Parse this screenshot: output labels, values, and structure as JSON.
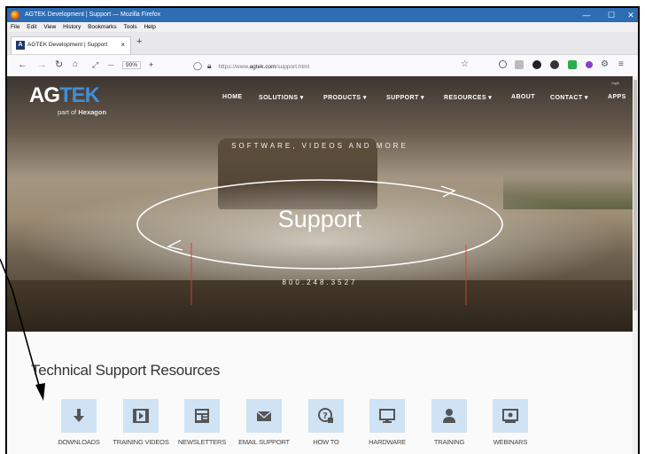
{
  "browser": {
    "window_title": "AGTEK Development | Support — Mozilla Firefox",
    "menu": [
      "File",
      "Edit",
      "View",
      "History",
      "Bookmarks",
      "Tools",
      "Help"
    ],
    "tab_title": "AGTEK Development | Support",
    "tab_close": "×",
    "new_tab": "+",
    "zoom_minus": "—",
    "zoom_level": "90%",
    "zoom_plus": "+",
    "url_prefix": "https://www.",
    "url_domain": "agtek.com",
    "url_path": "/support.html",
    "win_minimize": "—",
    "win_maximize": "☐",
    "win_close": "✕"
  },
  "site": {
    "logo_ag": "AG",
    "logo_tek": "TEK",
    "logo_sub_prefix": "part of ",
    "logo_sub_brand": "Hexagon",
    "login": "login",
    "nav": [
      "HOME",
      "SOLUTIONS ▾",
      "PRODUCTS ▾",
      "SUPPORT ▾",
      "RESOURCES ▾",
      "ABOUT",
      "CONTACT ▾",
      "APPS"
    ]
  },
  "hero": {
    "tagline": "SOFTWARE, VIDEOS AND MORE",
    "title": "Support",
    "phone": "800.248.3527"
  },
  "resources": {
    "title": "Technical Support Resources",
    "items": [
      {
        "label": "DOWNLOADS",
        "icon": "download-icon"
      },
      {
        "label": "TRAINING VIDEOS",
        "icon": "video-icon"
      },
      {
        "label": "NEWSLETTERS",
        "icon": "newsletter-icon"
      },
      {
        "label": "EMAIL SUPPORT",
        "icon": "envelope-icon"
      },
      {
        "label": "HOW TO",
        "icon": "help-icon"
      },
      {
        "label": "HARDWARE",
        "icon": "monitor-icon"
      },
      {
        "label": "TRAINING",
        "icon": "trainer-icon"
      },
      {
        "label": "WEBINARS",
        "icon": "webinar-icon"
      }
    ]
  },
  "colors": {
    "titlebar": "#2d6db4",
    "brand_blue": "#3f8fd6",
    "icon_tile": "#cfe3f5",
    "icon_fg": "#555555"
  }
}
